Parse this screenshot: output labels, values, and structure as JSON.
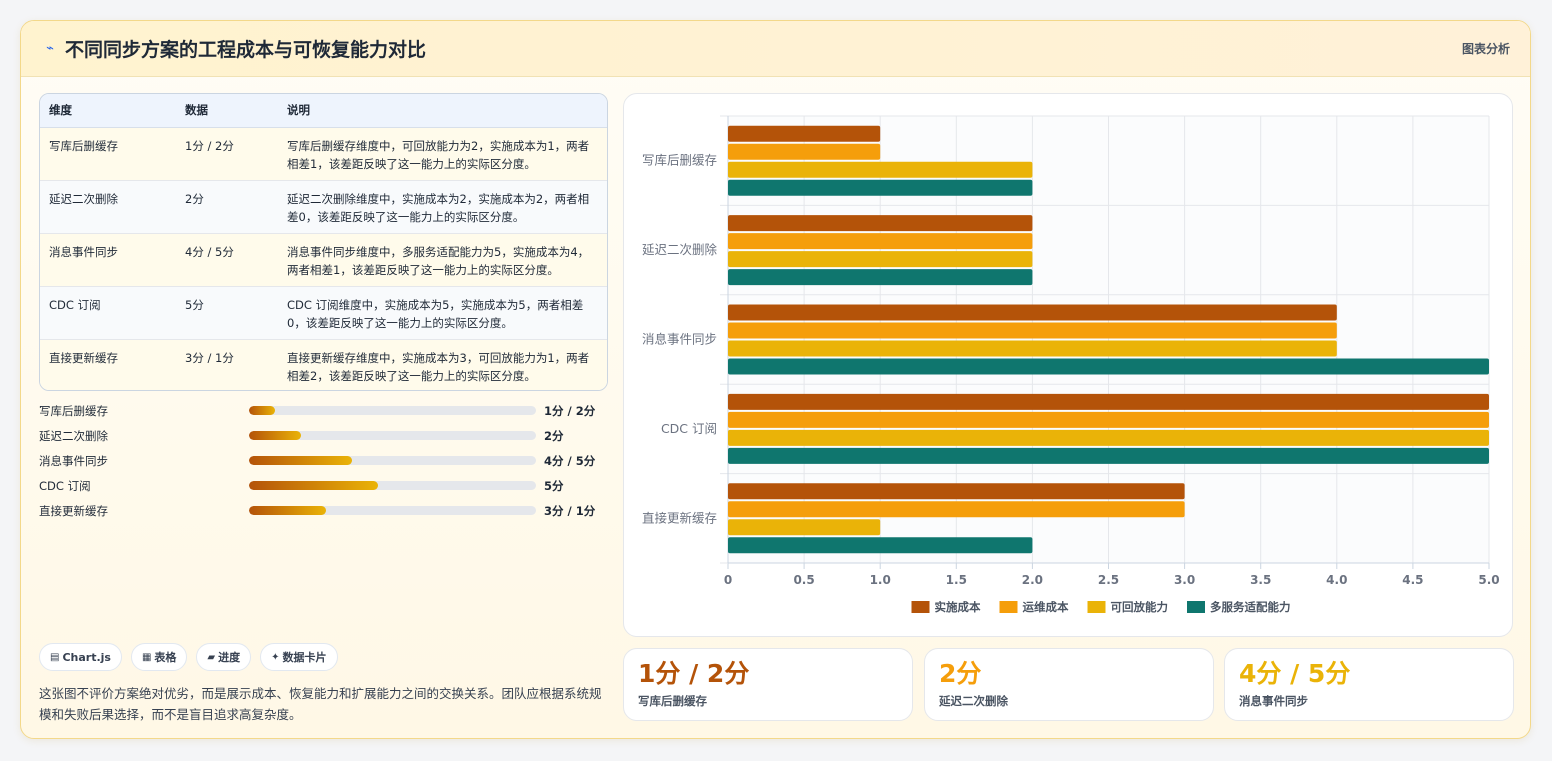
{
  "header": {
    "title": "不同同步方案的工程成本与可恢复能力对比",
    "tag": "图表分析",
    "icon": "bolt-icon"
  },
  "table": {
    "headers": [
      "维度",
      "数据",
      "说明"
    ],
    "rows": [
      {
        "dim": "写库后删缓存",
        "data": "1分 / 2分",
        "desc": "写库后删缓存维度中，可回放能力为2，实施成本为1，两者相差1，该差距反映了这一能力上的实际区分度。"
      },
      {
        "dim": "延迟二次删除",
        "data": "2分",
        "desc": "延迟二次删除维度中，实施成本为2，实施成本为2，两者相差0，该差距反映了这一能力上的实际区分度。"
      },
      {
        "dim": "消息事件同步",
        "data": "4分 / 5分",
        "desc": "消息事件同步维度中，多服务适配能力为5，实施成本为4，两者相差1，该差距反映了这一能力上的实际区分度。"
      },
      {
        "dim": "CDC 订阅",
        "data": "5分",
        "desc": "CDC 订阅维度中，实施成本为5，实施成本为5，两者相差0，该差距反映了这一能力上的实际区分度。"
      },
      {
        "dim": "直接更新缓存",
        "data": "3分 / 1分",
        "desc": "直接更新缓存维度中，实施成本为3，可回放能力为1，两者相差2，该差距反映了这一能力上的实际区分度。"
      }
    ]
  },
  "progress": [
    {
      "label": "写库后删缓存",
      "value": "1分 / 2分",
      "fraction": 0.09
    },
    {
      "label": "延迟二次删除",
      "value": "2分",
      "fraction": 0.18
    },
    {
      "label": "消息事件同步",
      "value": "4分 / 5分",
      "fraction": 0.36
    },
    {
      "label": "CDC 订阅",
      "value": "5分",
      "fraction": 0.45
    },
    {
      "label": "直接更新缓存",
      "value": "3分 / 1分",
      "fraction": 0.27
    }
  ],
  "chips": [
    {
      "icon": "chart-icon",
      "glyph": "▤",
      "label": "Chart.js"
    },
    {
      "icon": "table-icon",
      "glyph": "▦",
      "label": "表格"
    },
    {
      "icon": "progress-icon",
      "glyph": "▰",
      "label": "进度"
    },
    {
      "icon": "card-icon",
      "glyph": "✦",
      "label": "数据卡片"
    }
  ],
  "note": "这张图不评价方案绝对优劣，而是展示成本、恢复能力和扩展能力之间的交换关系。团队应根据系统规模和失败后果选择，而不是盲目追求高复杂度。",
  "stats": [
    {
      "value": "1分 / 2分",
      "label": "写库后删缓存",
      "color": "#b45309"
    },
    {
      "value": "2分",
      "label": "延迟二次删除",
      "color": "#f59e0b"
    },
    {
      "value": "4分 / 5分",
      "label": "消息事件同步",
      "color": "#eab308"
    }
  ],
  "chart_data": {
    "type": "bar",
    "orientation": "horizontal",
    "categories": [
      "写库后删缓存",
      "延迟二次删除",
      "消息事件同步",
      "CDC 订阅",
      "直接更新缓存"
    ],
    "series": [
      {
        "name": "实施成本",
        "color": "#b45309",
        "values": [
          1,
          2,
          4,
          5,
          3
        ]
      },
      {
        "name": "运维成本",
        "color": "#f59e0b",
        "values": [
          1,
          2,
          4,
          5,
          3
        ]
      },
      {
        "name": "可回放能力",
        "color": "#eab308",
        "values": [
          2,
          2,
          4,
          5,
          1
        ]
      },
      {
        "name": "多服务适配能力",
        "color": "#0f766e",
        "values": [
          2,
          2,
          5,
          5,
          2
        ]
      }
    ],
    "xlim": [
      0,
      5
    ],
    "xticks": [
      "0",
      "0.5",
      "1.0",
      "1.5",
      "2.0",
      "2.5",
      "3.0",
      "3.5",
      "4.0",
      "4.5",
      "5.0"
    ],
    "grid": true,
    "legend": "bottom"
  }
}
